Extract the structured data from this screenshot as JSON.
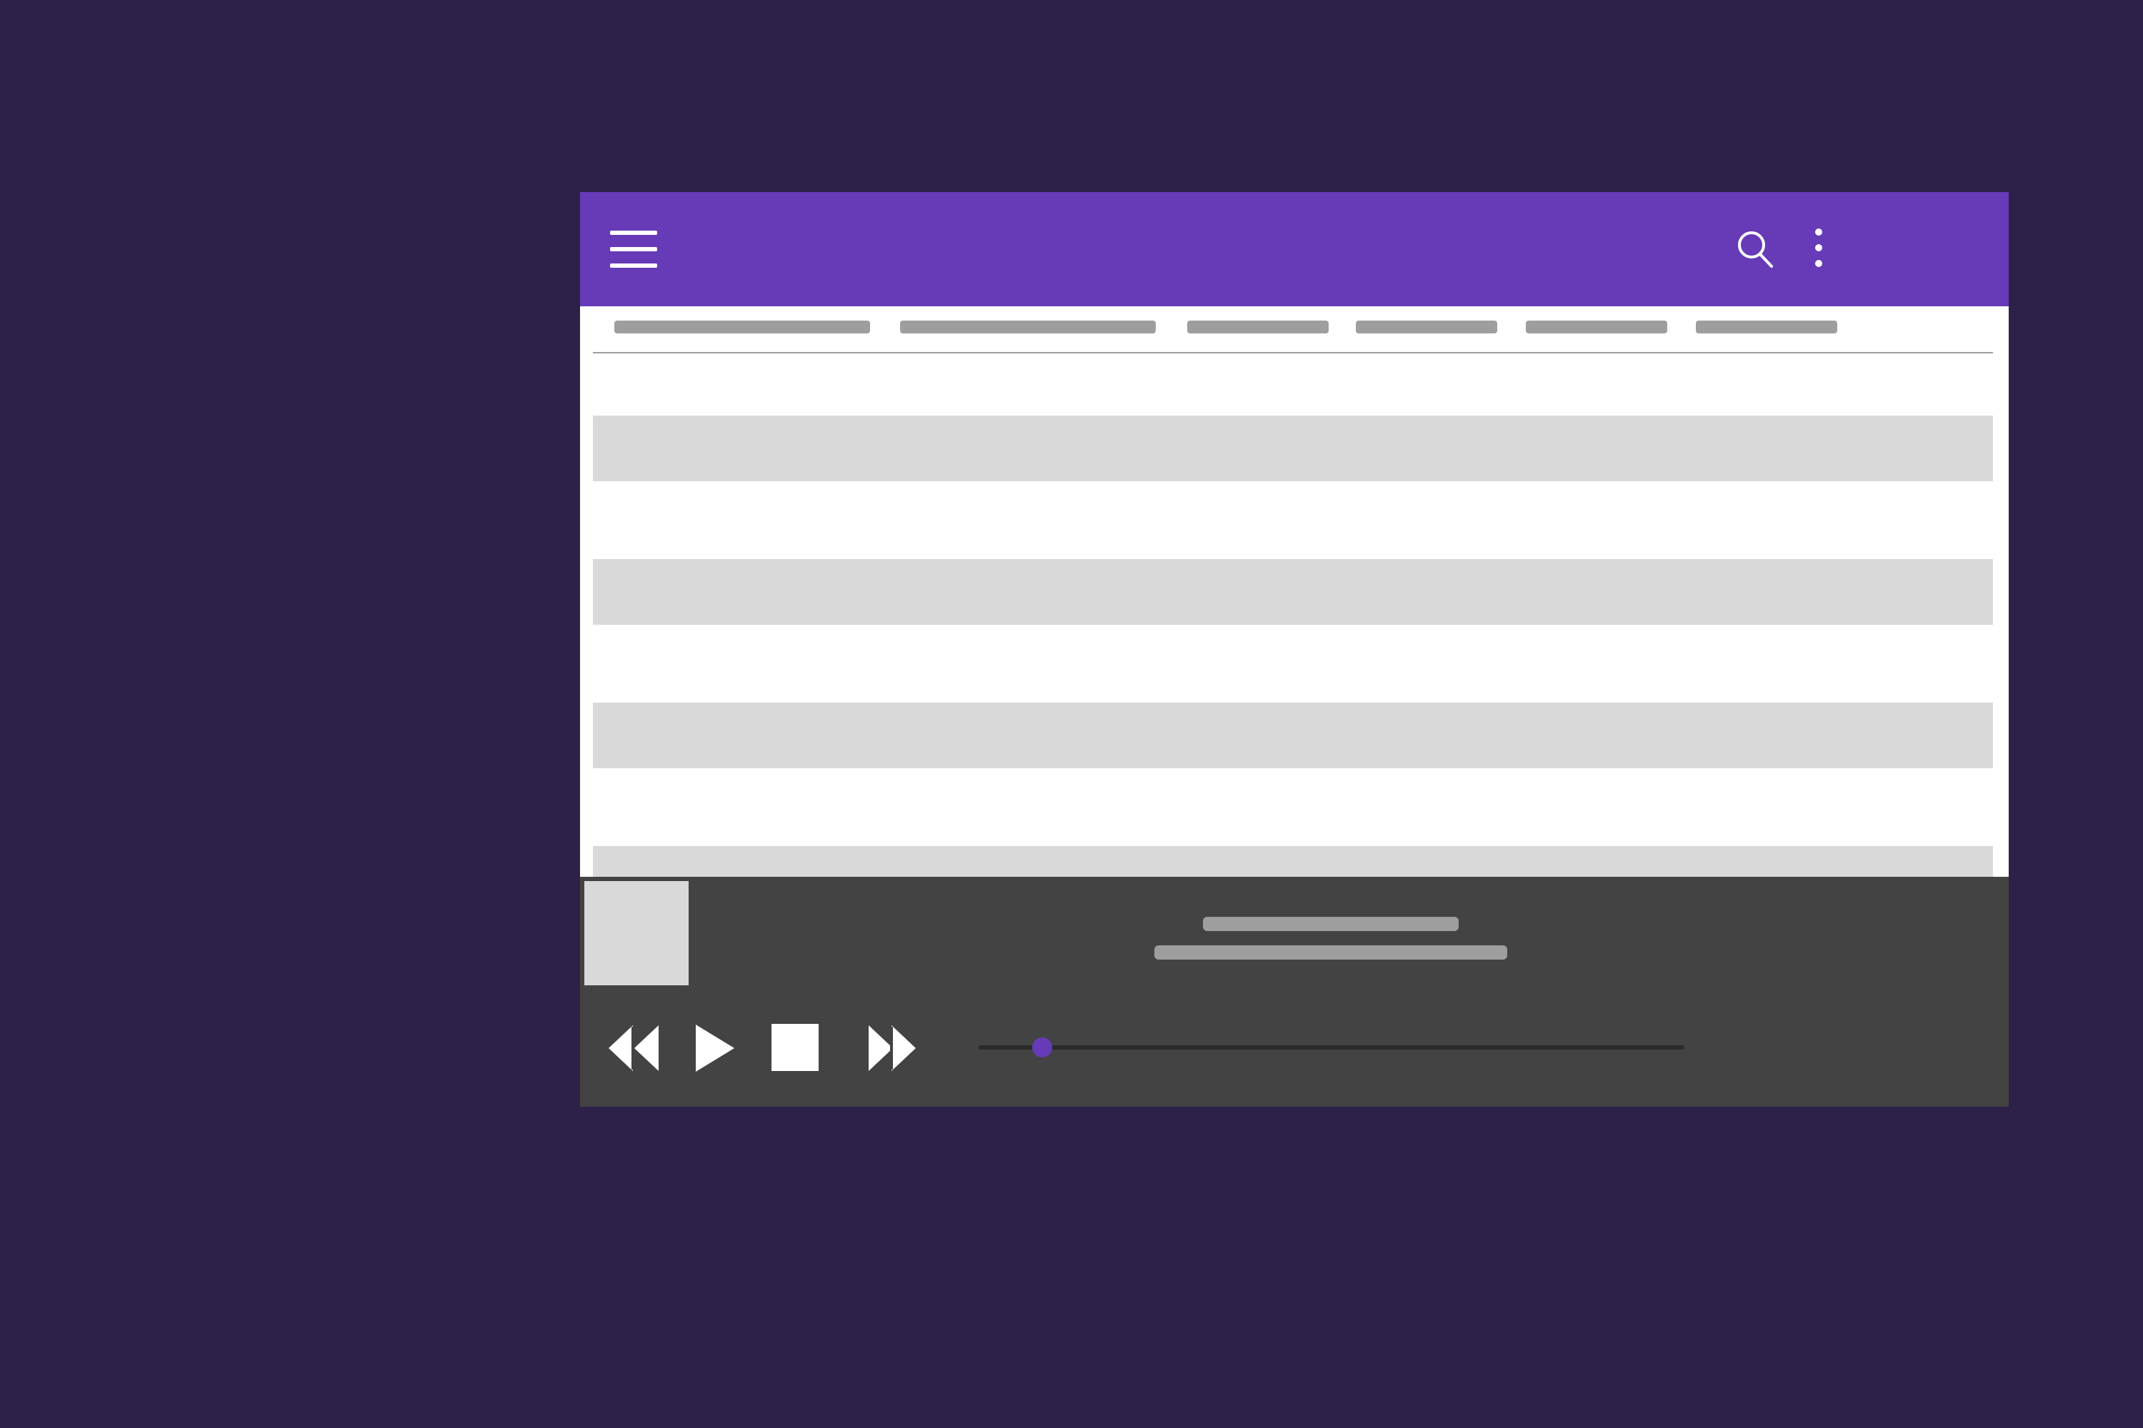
{
  "colors": {
    "background": "#2d2149",
    "app_bar": "#673ab7",
    "player": "#434343",
    "accent": "#673ab7",
    "placeholder": "#9e9e9e",
    "row_shade": "#d9d9d9"
  },
  "app_bar": {
    "menu_icon": "hamburger-menu-icon",
    "search_icon": "search-icon",
    "more_icon": "more-vert-icon"
  },
  "table": {
    "columns": [
      "",
      "",
      "",
      "",
      "",
      ""
    ],
    "rows": [
      "",
      "",
      "",
      "",
      "",
      "",
      "",
      ""
    ]
  },
  "player": {
    "track_title": "",
    "track_artist": "",
    "progress": 0.09,
    "controls": [
      "rewind-icon",
      "play-icon",
      "stop-icon",
      "fast-forward-icon"
    ]
  }
}
